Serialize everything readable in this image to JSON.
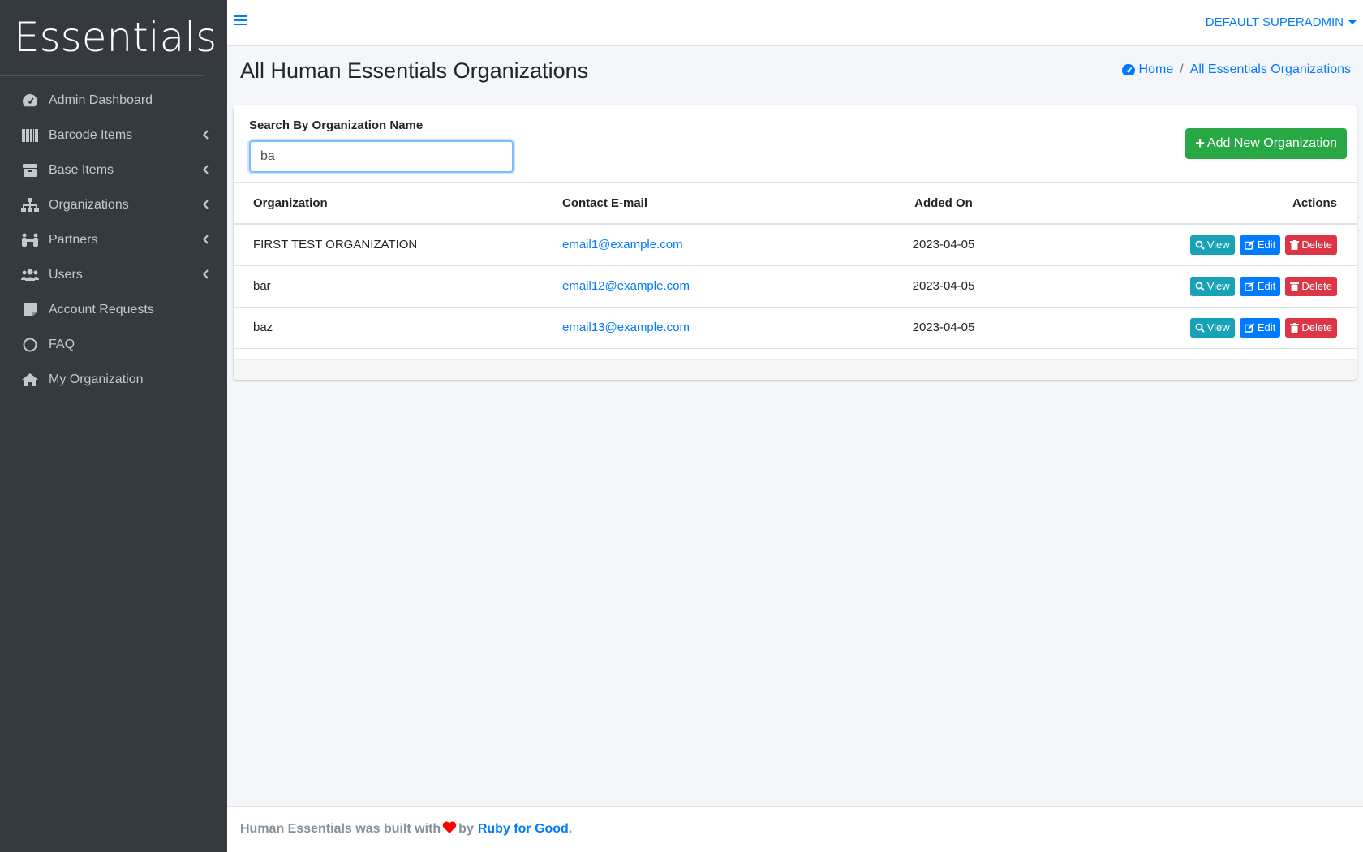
{
  "brand": {
    "name": "Essentials"
  },
  "sidebar": {
    "items": [
      {
        "label": "Admin Dashboard",
        "icon": "tachometer-icon",
        "has_children": false
      },
      {
        "label": "Barcode Items",
        "icon": "barcode-icon",
        "has_children": true
      },
      {
        "label": "Base Items",
        "icon": "box-icon",
        "has_children": true
      },
      {
        "label": "Organizations",
        "icon": "sitemap-icon",
        "has_children": true
      },
      {
        "label": "Partners",
        "icon": "partners-icon",
        "has_children": true
      },
      {
        "label": "Users",
        "icon": "users-icon",
        "has_children": true
      },
      {
        "label": "Account Requests",
        "icon": "note-icon",
        "has_children": false
      },
      {
        "label": "FAQ",
        "icon": "circle-icon",
        "has_children": false
      },
      {
        "label": "My Organization",
        "icon": "home-icon",
        "has_children": false
      }
    ]
  },
  "topbar": {
    "user": "DEFAULT SUPERADMIN"
  },
  "page": {
    "title": "All Human Essentials Organizations"
  },
  "breadcrumb": {
    "home": "Home",
    "separator": "/",
    "current": "All Essentials Organizations"
  },
  "search": {
    "label": "Search By Organization Name",
    "value": "ba"
  },
  "actions": {
    "add_label": "Add New Organization"
  },
  "table": {
    "headers": {
      "organization": "Organization",
      "email": "Contact E-mail",
      "added_on": "Added On",
      "actions": "Actions"
    },
    "rows": [
      {
        "organization": "FIRST TEST ORGANIZATION",
        "email": "email1@example.com",
        "added_on": "2023-04-05"
      },
      {
        "organization": "bar",
        "email": "email12@example.com",
        "added_on": "2023-04-05"
      },
      {
        "organization": "baz",
        "email": "email13@example.com",
        "added_on": "2023-04-05"
      }
    ],
    "row_actions": {
      "view": "View",
      "edit": "Edit",
      "delete": "Delete"
    }
  },
  "footer": {
    "prefix": "Human Essentials was built with",
    "middle": "by",
    "link": "Ruby for Good",
    "suffix": "."
  },
  "colors": {
    "sidebar_bg": "#343a40",
    "link": "#007bff",
    "success": "#28a745",
    "info": "#17a2b8",
    "danger": "#dc3545"
  }
}
